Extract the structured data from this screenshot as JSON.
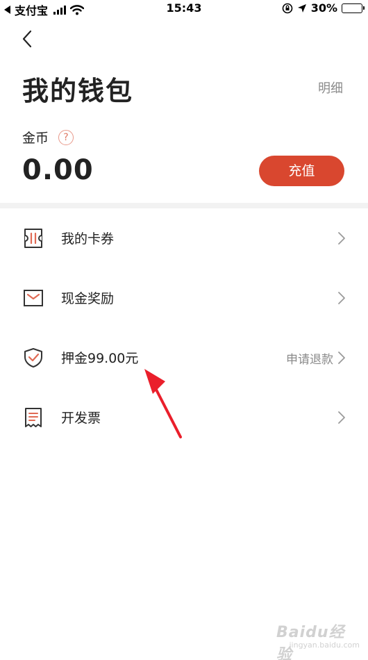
{
  "status_bar": {
    "carrier": "支付宝",
    "time": "15:43",
    "battery": "30%",
    "battery_level": 0.3
  },
  "header": {
    "title": "我的钱包",
    "detail_link": "明细"
  },
  "coins": {
    "label": "金币",
    "help_glyph": "?",
    "value": "0.00",
    "recharge_label": "充值"
  },
  "menu": {
    "coupons": {
      "label": "我的卡券",
      "icon": "ticket-icon"
    },
    "cash_rewards": {
      "label": "现金奖励",
      "icon": "envelope-icon"
    },
    "deposit": {
      "label": "押金99.00元",
      "right_text": "申请退款",
      "icon": "shield-check-icon"
    },
    "invoice": {
      "label": "开发票",
      "icon": "receipt-icon"
    }
  },
  "colors": {
    "accent": "#d9472f",
    "icon_accent": "#e06a54",
    "icon_dark": "#333333",
    "annotation": "#ea1f2b"
  },
  "watermark": {
    "main": "Baidu经验",
    "sub": "jingyan.baidu.com"
  }
}
